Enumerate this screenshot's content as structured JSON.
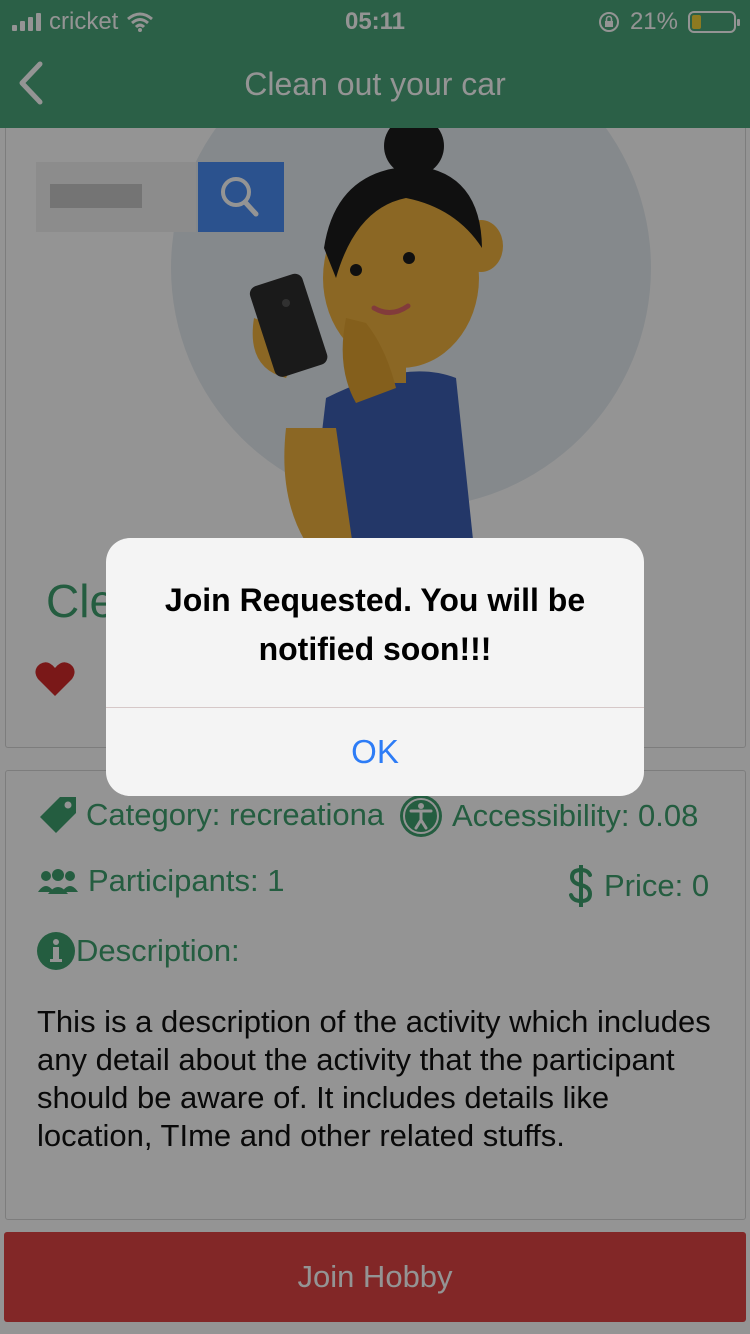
{
  "status_bar": {
    "carrier": "cricket",
    "time": "05:11",
    "battery": "21%"
  },
  "nav": {
    "title": "Clean out your car",
    "back_icon": "chevron-left-icon"
  },
  "activity": {
    "title_visible": "Cle",
    "favorite_icon": "heart-icon",
    "favorite_color": "#d22a2a"
  },
  "details": {
    "category": "Category: recreationa",
    "accessibility": "Accessibility: 0.08",
    "participants": "Participants: 1",
    "price": "Price: 0",
    "description_label": "Description:",
    "description": "This is a description of the activity which includes any detail about the activity that the participant should be aware of. It includes details like location, TIme and other related stuffs."
  },
  "join_button": {
    "label": "Join Hobby"
  },
  "alert": {
    "message": "Join Requested. You will be notified soon!!!",
    "ok_label": "OK"
  },
  "colors": {
    "primary_green": "#4aa57a",
    "accent_green": "#3fa06e",
    "join_red": "#e04444",
    "alert_blue": "#2d7cf6"
  }
}
